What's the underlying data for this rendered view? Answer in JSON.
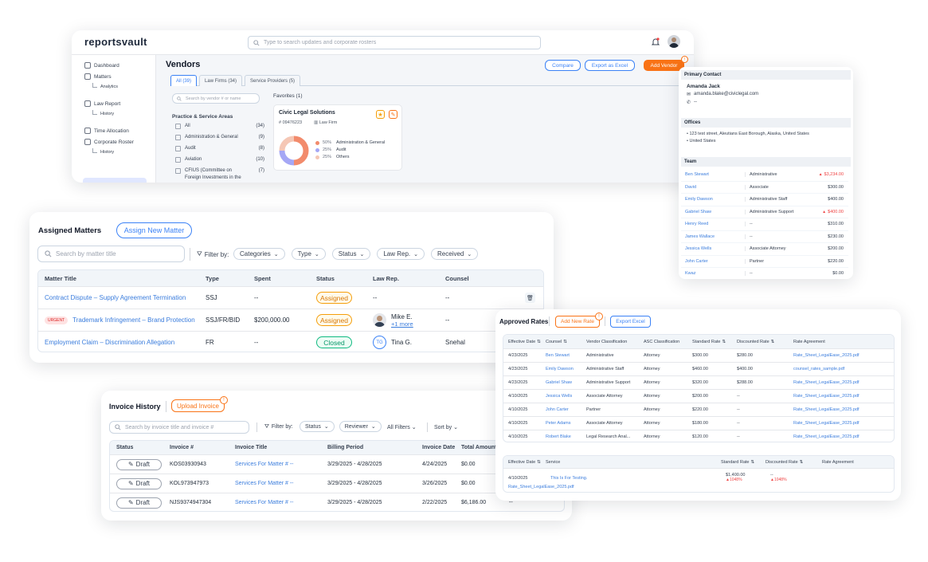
{
  "vault": {
    "logo": "reportsvault",
    "search_placeholder": "Type to search updates and corporate rosters",
    "sidebar": [
      {
        "label": "Dashboard",
        "icon": "dashboard-icon"
      },
      {
        "label": "Matters",
        "icon": "matters-icon"
      },
      {
        "label": "Analytics",
        "sub": true
      },
      {
        "label": "Law Report",
        "icon": "scale-icon"
      },
      {
        "label": "History",
        "sub": true
      },
      {
        "label": "Time Allocation",
        "icon": "clock-icon"
      },
      {
        "label": "Corporate Roster",
        "icon": "roster-icon"
      },
      {
        "label": "History",
        "sub": true
      }
    ],
    "page_title": "Vendors",
    "compare_label": "Compare",
    "export_label": "Export as Excel",
    "add_vendor_label": "Add Vendor",
    "tabs": [
      "All (39)",
      "Law Firms (34)",
      "Service Providers (5)"
    ],
    "vendor_search_placeholder": "Search by vendor # or name",
    "filter_title": "Practice & Service Areas",
    "filters": [
      {
        "label": "All",
        "count": "(34)"
      },
      {
        "label": "Administration & General",
        "count": "(9)"
      },
      {
        "label": "Audit",
        "count": "(8)"
      },
      {
        "label": "Aviation",
        "count": "(10)"
      },
      {
        "label": "CFIUS (Committee on Foreign Investments in the U.S.)",
        "count": "(7)"
      }
    ],
    "favorites_label": "Favorites (1)",
    "vendor_card": {
      "name": "Civic Legal Solutions",
      "number": "09476223",
      "type": "Law Firm",
      "legend": [
        {
          "pct": "50%",
          "label": "Administration & General",
          "color": "#f28b6c"
        },
        {
          "pct": "25%",
          "label": "Audit",
          "color": "#a5a7f5"
        },
        {
          "pct": "25%",
          "label": "Others",
          "color": "#f5c7b5"
        }
      ]
    }
  },
  "contact": {
    "primary_title": "Primary Contact",
    "name": "Amanda Jack",
    "email": "amanda.blake@civiclegal.com",
    "phone": "--",
    "offices_title": "Offices",
    "offices": [
      "123 test street, Aleutians East Borough, Alaska, United States",
      "United States"
    ],
    "team_title": "Team",
    "team": [
      {
        "name": "Ben Stewart",
        "role": "Administrative",
        "rate": "$3,234.00",
        "up": true
      },
      {
        "name": "David",
        "role": "Associate",
        "rate": "$300.00",
        "up": false
      },
      {
        "name": "Emily Dawson",
        "role": "Administrative Staff",
        "rate": "$400.00",
        "up": false
      },
      {
        "name": "Gabriel Shaw",
        "role": "Administrative Support",
        "rate": "$400.00",
        "up": true
      },
      {
        "name": "Henry Reed",
        "role": "--",
        "rate": "$310.00",
        "up": false
      },
      {
        "name": "James Wallace",
        "role": "--",
        "rate": "$230.00",
        "up": false
      },
      {
        "name": "Jessica Wells",
        "role": "Associate Attorney",
        "rate": "$200.00",
        "up": false
      },
      {
        "name": "John Carter",
        "role": "Partner",
        "rate": "$220.00",
        "up": false
      },
      {
        "name": "Kwaz",
        "role": "--",
        "rate": "$0.00",
        "up": false
      }
    ]
  },
  "matters": {
    "title": "Assigned Matters",
    "assign_label": "Assign New Matter",
    "search_placeholder": "Search by matter title",
    "filter_by": "Filter by:",
    "filters": [
      "Categories",
      "Type",
      "Status",
      "Law Rep.",
      "Received"
    ],
    "headers": [
      "Matter Title",
      "Type",
      "Spent",
      "Status",
      "Law Rep.",
      "Counsel"
    ],
    "rows": [
      {
        "title": "Contract Dispute – Supply Agreement Termination",
        "urgent": "",
        "type": "SSJ",
        "spent": "--",
        "status": "Assigned",
        "rep": "--",
        "rep2": "",
        "counsel": "--",
        "avatar": "none"
      },
      {
        "title": "Trademark Infringement – Brand Protection",
        "urgent": "URGENT",
        "type": "SSJ/FR/BID",
        "spent": "$200,000.00",
        "status": "Assigned",
        "rep": "Mike E.",
        "rep2": "+1 more",
        "counsel": "--",
        "avatar": "photo"
      },
      {
        "title": "Employment Claim – Discrimination Allegation",
        "urgent": "",
        "type": "FR",
        "spent": "--",
        "status": "Closed",
        "rep": "Tina G.",
        "rep2": "",
        "counsel": "Snehal",
        "avatar": "TG"
      }
    ]
  },
  "invoices": {
    "title": "Invoice History",
    "upload_label": "Upload Invoice",
    "search_placeholder": "Search by invoice title and invoice #",
    "filter_by": "Filter by:",
    "filters": [
      "Status",
      "Reviewer"
    ],
    "all_filters": "All Filters",
    "sort_by": "Sort by",
    "headers": [
      "Status",
      "Invoice #",
      "Invoice Title",
      "Billing Period",
      "Invoice Date",
      "Total Amount"
    ],
    "rows": [
      {
        "status": "Draft",
        "number": "KOS03930943",
        "title": "Services For Matter # --",
        "period": "3/29/2025 - 4/28/2025",
        "date": "4/24/2025",
        "amount": "$0.00",
        "extra": ""
      },
      {
        "status": "Draft",
        "number": "KOL973947973",
        "title": "Services For Matter # --",
        "period": "3/29/2025 - 4/28/2025",
        "date": "3/26/2025",
        "amount": "$0.00",
        "extra": ""
      },
      {
        "status": "Draft",
        "number": "NJS9374947304",
        "title": "Services For Matter # --",
        "period": "3/29/2025 - 4/28/2025",
        "date": "2/22/2025",
        "amount": "$6,186.00",
        "extra": "--"
      }
    ]
  },
  "rates": {
    "title": "Approved Rates",
    "add_label": "Add New Rate",
    "export_label": "Export Excel",
    "headers": [
      "Effective Date",
      "Counsel",
      "Vendor Classification",
      "ASC Classification",
      "Standard Rate",
      "Discounted Rate",
      "Rate Agreement"
    ],
    "rows": [
      {
        "date": "4/23/2025",
        "counsel": "Ben Stewart",
        "vendor": "Administrative",
        "asc": "Attorney",
        "std": "$300.00",
        "disc": "$280.00",
        "agreement": "Rate_Sheet_LegalEase_2025.pdf"
      },
      {
        "date": "4/23/2025",
        "counsel": "Emily Dawson",
        "vendor": "Administrative Staff",
        "asc": "Attorney",
        "std": "$460.00",
        "disc": "$400.00",
        "agreement": "counsel_rates_sample.pdf"
      },
      {
        "date": "4/23/2025",
        "counsel": "Gabriel Shaw",
        "vendor": "Administrative Support",
        "asc": "Attorney",
        "std": "$320.00",
        "disc": "$288.00",
        "agreement": "Rate_Sheet_LegalEase_2025.pdf"
      },
      {
        "date": "4/10/2025",
        "counsel": "Jessica Wells",
        "vendor": "Associate Attorney",
        "asc": "Attorney",
        "std": "$200.00",
        "disc": "--",
        "agreement": "Rate_Sheet_LegalEase_2025.pdf"
      },
      {
        "date": "4/10/2025",
        "counsel": "John Carter",
        "vendor": "Partner",
        "asc": "Attorney",
        "std": "$220.00",
        "disc": "--",
        "agreement": "Rate_Sheet_LegalEase_2025.pdf"
      },
      {
        "date": "4/10/2025",
        "counsel": "Peter Adams",
        "vendor": "Associate Attorney",
        "asc": "Attorney",
        "std": "$180.00",
        "disc": "--",
        "agreement": "Rate_Sheet_LegalEase_2025.pdf"
      },
      {
        "date": "4/10/2025",
        "counsel": "Robert Blake",
        "vendor": "Legal Research Anal...",
        "asc": "Attorney",
        "std": "$120.00",
        "disc": "--",
        "agreement": "Rate_Sheet_LegalEase_2025.pdf"
      }
    ],
    "service_headers": [
      "Effective Date",
      "Service",
      "Standard Rate",
      "Discounted Rate",
      "Rate Agreement"
    ],
    "service_row": {
      "date": "4/10/2025",
      "service": "This Is For Testing.",
      "agreement": "Rate_Sheet_LegalEase_2025.pdf",
      "std": "$1,400.00",
      "std_change": "1048%",
      "disc": "--",
      "disc_change": "1048%"
    }
  }
}
